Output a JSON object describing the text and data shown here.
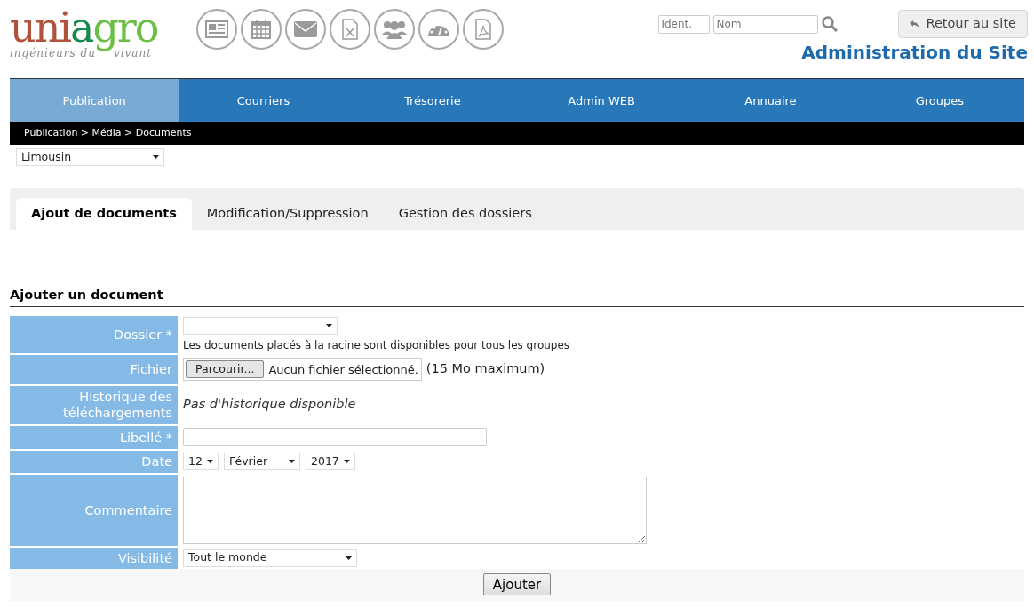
{
  "logo": {
    "parts": [
      {
        "text": "uni",
        "color": "#b0533c"
      },
      {
        "text": "a",
        "color": "#17894a"
      },
      {
        "text": "gro",
        "color": "#6cbf45"
      }
    ],
    "tagline_left": "ingénieurs du",
    "tagline_right": "vivant"
  },
  "login": {
    "ident_placeholder": "Ident.",
    "nom_placeholder": "Nom"
  },
  "back_button": "Retour au site",
  "site_title": "Administration du Site",
  "nav": [
    {
      "label": "Publication",
      "selected": true
    },
    {
      "label": "Courriers",
      "selected": false
    },
    {
      "label": "Trésorerie",
      "selected": false
    },
    {
      "label": "Admin WEB",
      "selected": false
    },
    {
      "label": "Annuaire",
      "selected": false
    },
    {
      "label": "Groupes",
      "selected": false
    }
  ],
  "breadcrumb": "Publication > Média > Documents",
  "region_select": "Limousin",
  "tabs": [
    {
      "label": "Ajout de documents",
      "selected": true
    },
    {
      "label": "Modification/Suppression",
      "selected": false
    },
    {
      "label": "Gestion des dossiers",
      "selected": false
    }
  ],
  "section_title": "Ajouter un document",
  "form": [
    {
      "kind": "folder",
      "label": "Dossier *",
      "hint": "Les documents placés à la racine sont disponibles pour tous les groupes"
    },
    {
      "kind": "file",
      "label": "Fichier",
      "button": "Parcourir...",
      "status": "Aucun fichier sélectionné.",
      "note": "(15 Mo maximum)"
    },
    {
      "kind": "history",
      "label": "Historique des téléchargements",
      "text": "Pas d'historique disponible"
    },
    {
      "kind": "text",
      "label": "Libellé *"
    },
    {
      "kind": "date",
      "label": "Date",
      "day": "12",
      "month": "Février",
      "year": "2017"
    },
    {
      "kind": "textarea",
      "label": "Commentaire"
    },
    {
      "kind": "select",
      "label": "Visibilité",
      "value": "Tout le monde"
    }
  ],
  "submit": "Ajouter"
}
